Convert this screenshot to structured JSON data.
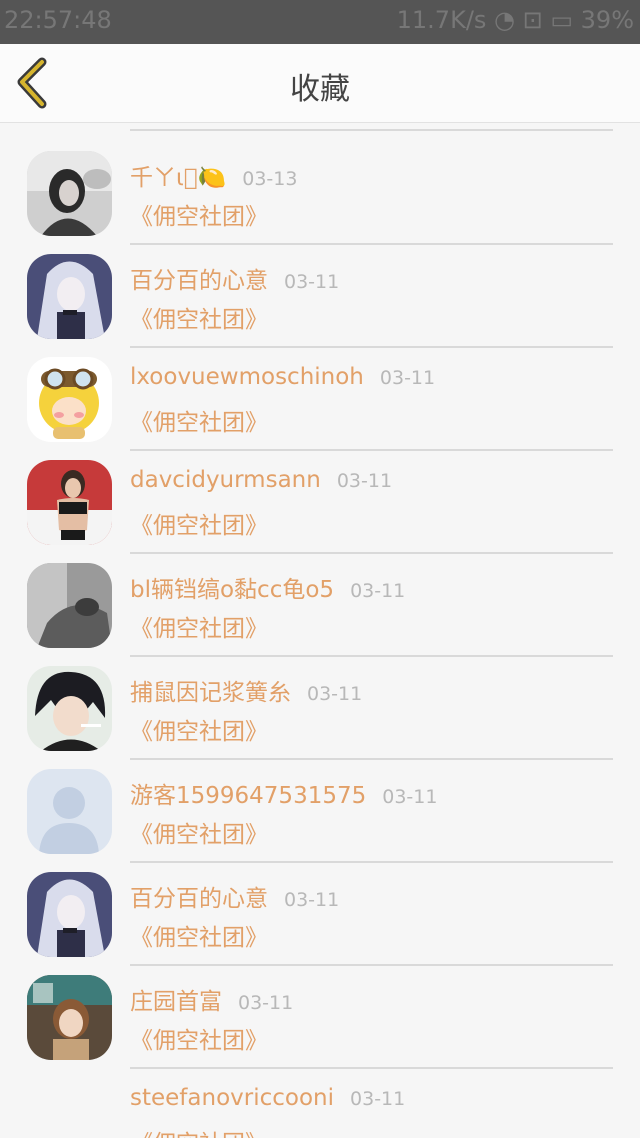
{
  "status_bar": {
    "time": "22:57:48",
    "right": "11.7K/s ◔ ⊡ ▭ 39%"
  },
  "header": {
    "title": "收藏",
    "back_icon": "chevron-left-icon",
    "accent": "#d6b52e"
  },
  "colors": {
    "name": "#e2a068",
    "date": "#b8b8b8",
    "divider": "#d9d9d9"
  },
  "favorites": [
    {
      "name": "千ㄚι⃝🍋",
      "date": "03-13",
      "group": "《佣空社团》",
      "avatar": "girl-photo-avatar"
    },
    {
      "name": "百分百的心意",
      "date": "03-11",
      "group": "《佣空社团》",
      "avatar": "anime-girl-avatar"
    },
    {
      "name": "lxoovuewmoschinoh",
      "date": "03-11",
      "group": "《佣空社团》",
      "avatar": "cartoon-pilot-avatar"
    },
    {
      "name": "davcidyurmsann",
      "date": "03-11",
      "group": "《佣空社团》",
      "avatar": "woman-photo-avatar"
    },
    {
      "name": "bl辆铛缟o黏cc龟o5",
      "date": "03-11",
      "group": "《佣空社团》",
      "avatar": "grayscale-photo-avatar"
    },
    {
      "name": "捕鼠因记浆簧糸",
      "date": "03-11",
      "group": "《佣空社团》",
      "avatar": "anime-boy-avatar"
    },
    {
      "name": "游客1599647531575",
      "date": "03-11",
      "group": "《佣空社团》",
      "avatar": "default-user-avatar"
    },
    {
      "name": "百分百的心意",
      "date": "03-11",
      "group": "《佣空社团》",
      "avatar": "anime-girl-avatar"
    },
    {
      "name": "庄园首富",
      "date": "03-11",
      "group": "《佣空社团》",
      "avatar": "anime-art-avatar"
    },
    {
      "name": "steefanovriccooni",
      "date": "03-11",
      "group": "《佣空社团》",
      "avatar": ""
    }
  ]
}
